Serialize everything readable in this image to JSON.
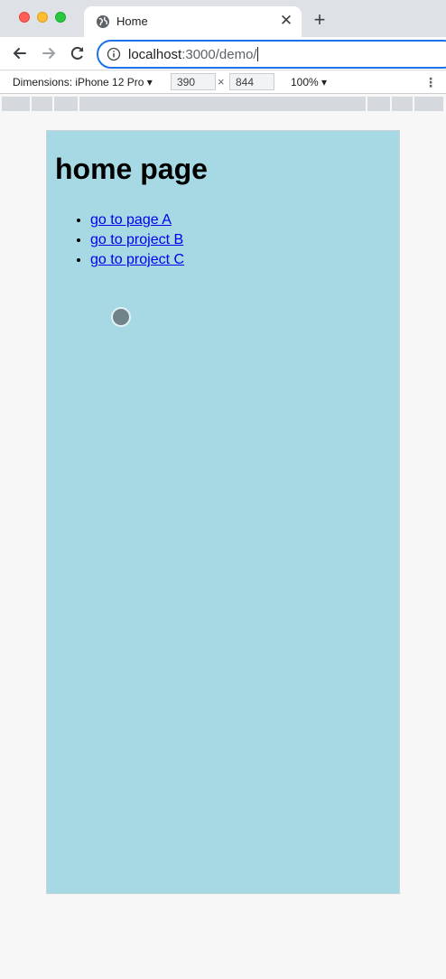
{
  "browser": {
    "tab_title": "Home",
    "tab_close": "✕",
    "new_tab": "+",
    "url_host": "localhost",
    "url_path": ":3000/demo/"
  },
  "device_toolbar": {
    "dimensions_label": "Dimensions: iPhone 12 Pro",
    "width": "390",
    "height": "844",
    "times": "×",
    "zoom": "100%",
    "more": "⋮"
  },
  "page": {
    "heading": "home page",
    "links": [
      {
        "label": "go to page A"
      },
      {
        "label": "go to project B"
      },
      {
        "label": "go to project C"
      }
    ]
  }
}
